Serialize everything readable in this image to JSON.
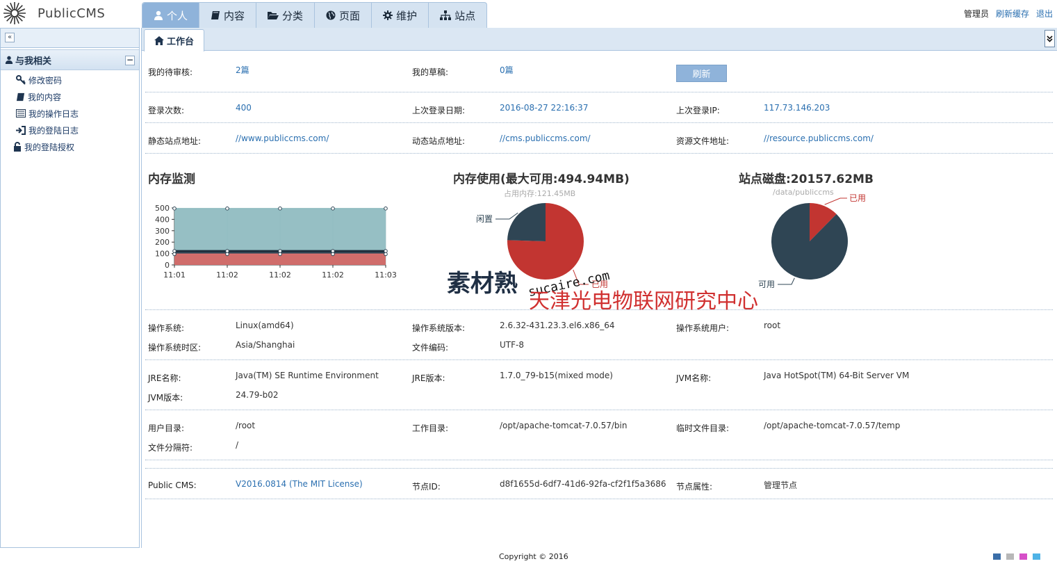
{
  "app": {
    "logo_text": "PublicCMS"
  },
  "nav": {
    "tabs": [
      {
        "label": "个人",
        "icon": "user-icon",
        "active": true
      },
      {
        "label": "内容",
        "icon": "book-icon"
      },
      {
        "label": "分类",
        "icon": "folder-open-icon"
      },
      {
        "label": "页面",
        "icon": "globe-icon"
      },
      {
        "label": "维护",
        "icon": "gear-icon"
      },
      {
        "label": "站点",
        "icon": "sitemap-icon"
      }
    ]
  },
  "user_links": {
    "username": "管理员",
    "refresh_cache": "刷新缓存",
    "logout": "退出"
  },
  "sidebar": {
    "collapse_glyph": "«",
    "group_title": "与我相关",
    "group_toggle": "−",
    "items": [
      {
        "label": "修改密码",
        "icon": "key-icon"
      },
      {
        "label": "我的内容",
        "icon": "book-icon"
      },
      {
        "label": "我的操作日志",
        "icon": "list-icon"
      },
      {
        "label": "我的登陆日志",
        "icon": "sign-in-icon"
      },
      {
        "label": "我的登陆授权",
        "icon": "unlock-icon"
      }
    ]
  },
  "main": {
    "tab_label": "工作台",
    "menu_glyph": "⌄",
    "refresh_button": "刷新",
    "info": {
      "pending_review_label": "我的待审核:",
      "pending_review_value": "2篇",
      "drafts_label": "我的草稿:",
      "drafts_value": "0篇",
      "login_count_label": "登录次数:",
      "login_count_value": "400",
      "last_login_date_label": "上次登录日期:",
      "last_login_date_value": "2016-08-27 22:16:37",
      "last_login_ip_label": "上次登录IP:",
      "last_login_ip_value": "117.73.146.203",
      "static_site_label": "静态站点地址:",
      "static_site_value": "//www.publiccms.com/",
      "dynamic_site_label": "动态站点地址:",
      "dynamic_site_value": "//cms.publiccms.com/",
      "resource_site_label": "资源文件地址:",
      "resource_site_value": "//resource.publiccms.com/"
    },
    "system": {
      "os_label": "操作系统:",
      "os_value": "Linux(amd64)",
      "os_version_label": "操作系统版本:",
      "os_version_value": "2.6.32-431.23.3.el6.x86_64",
      "os_user_label": "操作系统用户:",
      "os_user_value": "root",
      "os_tz_label": "操作系统时区:",
      "os_tz_value": "Asia/Shanghai",
      "file_encoding_label": "文件编码:",
      "file_encoding_value": "UTF-8",
      "jre_name_label": "JRE名称:",
      "jre_name_value": "Java(TM) SE Runtime Environment",
      "jre_version_label": "JRE版本:",
      "jre_version_value": "1.7.0_79-b15(mixed mode)",
      "jvm_name_label": "JVM名称:",
      "jvm_name_value": "Java HotSpot(TM) 64-Bit Server VM",
      "jvm_version_label": "JVM版本:",
      "jvm_version_value": "24.79-b02",
      "user_dir_label": "用户目录:",
      "user_dir_value": "/root",
      "work_dir_label": "工作目录:",
      "work_dir_value": "/opt/apache-tomcat-7.0.57/bin",
      "temp_dir_label": "临时文件目录:",
      "temp_dir_value": "/opt/apache-tomcat-7.0.57/temp",
      "file_sep_label": "文件分隔符:",
      "file_sep_value": "/",
      "cms_label": "Public CMS:",
      "cms_version": "V2016.0814",
      "cms_license_open": "(",
      "cms_license": "The MIT License",
      "cms_license_close": ")",
      "node_id_label": "节点ID:",
      "node_id_value": "d8f1655d-6df7-41d6-92fa-cf2f1f5a3686",
      "node_attr_label": "节点属性:",
      "node_attr_value": "管理节点"
    }
  },
  "chart_data": [
    {
      "type": "area",
      "title": "内存监测",
      "categories": [
        "11:01",
        "11:02",
        "11:02",
        "11:02",
        "11:03"
      ],
      "ylim": [
        0,
        500
      ],
      "yticks": [
        0,
        100,
        200,
        300,
        400,
        500
      ],
      "series": [
        {
          "values": [
            494.94,
            494.94,
            494.94,
            494.94,
            494.94
          ],
          "color": "#90bcc1"
        },
        {
          "values": [
            121.45,
            121.45,
            121.45,
            121.45,
            121.45
          ],
          "color": "#2f4554"
        },
        {
          "values": [
            95,
            95,
            95,
            95,
            95
          ],
          "color": "#d96f6d"
        }
      ],
      "grid": true
    },
    {
      "type": "pie",
      "title": "内存使用(最大可用:494.94MB)",
      "subtitle": "占用内存:121.45MB",
      "slices": [
        {
          "label": "已用",
          "value": 373.49,
          "color": "#c23531"
        },
        {
          "label": "闲置",
          "value": 121.45,
          "color": "#2f4554"
        }
      ]
    },
    {
      "type": "pie",
      "title": "站点磁盘:20157.62MB",
      "subtitle": "/data/publiccms",
      "slices": [
        {
          "label": "已用",
          "value": 2500,
          "color": "#c23531"
        },
        {
          "label": "可用",
          "value": 17657.62,
          "color": "#2f4554"
        }
      ]
    }
  ],
  "footer": {
    "copyright": "Copyright © 2016",
    "theme_colors": [
      "#3b6ea8",
      "#b8b8b8",
      "#d64fc8",
      "#4fb3e6"
    ]
  },
  "watermark": {
    "logo": "素材熟",
    "site": "sucaire.com",
    "text": "天津光电物联网研究中心"
  }
}
